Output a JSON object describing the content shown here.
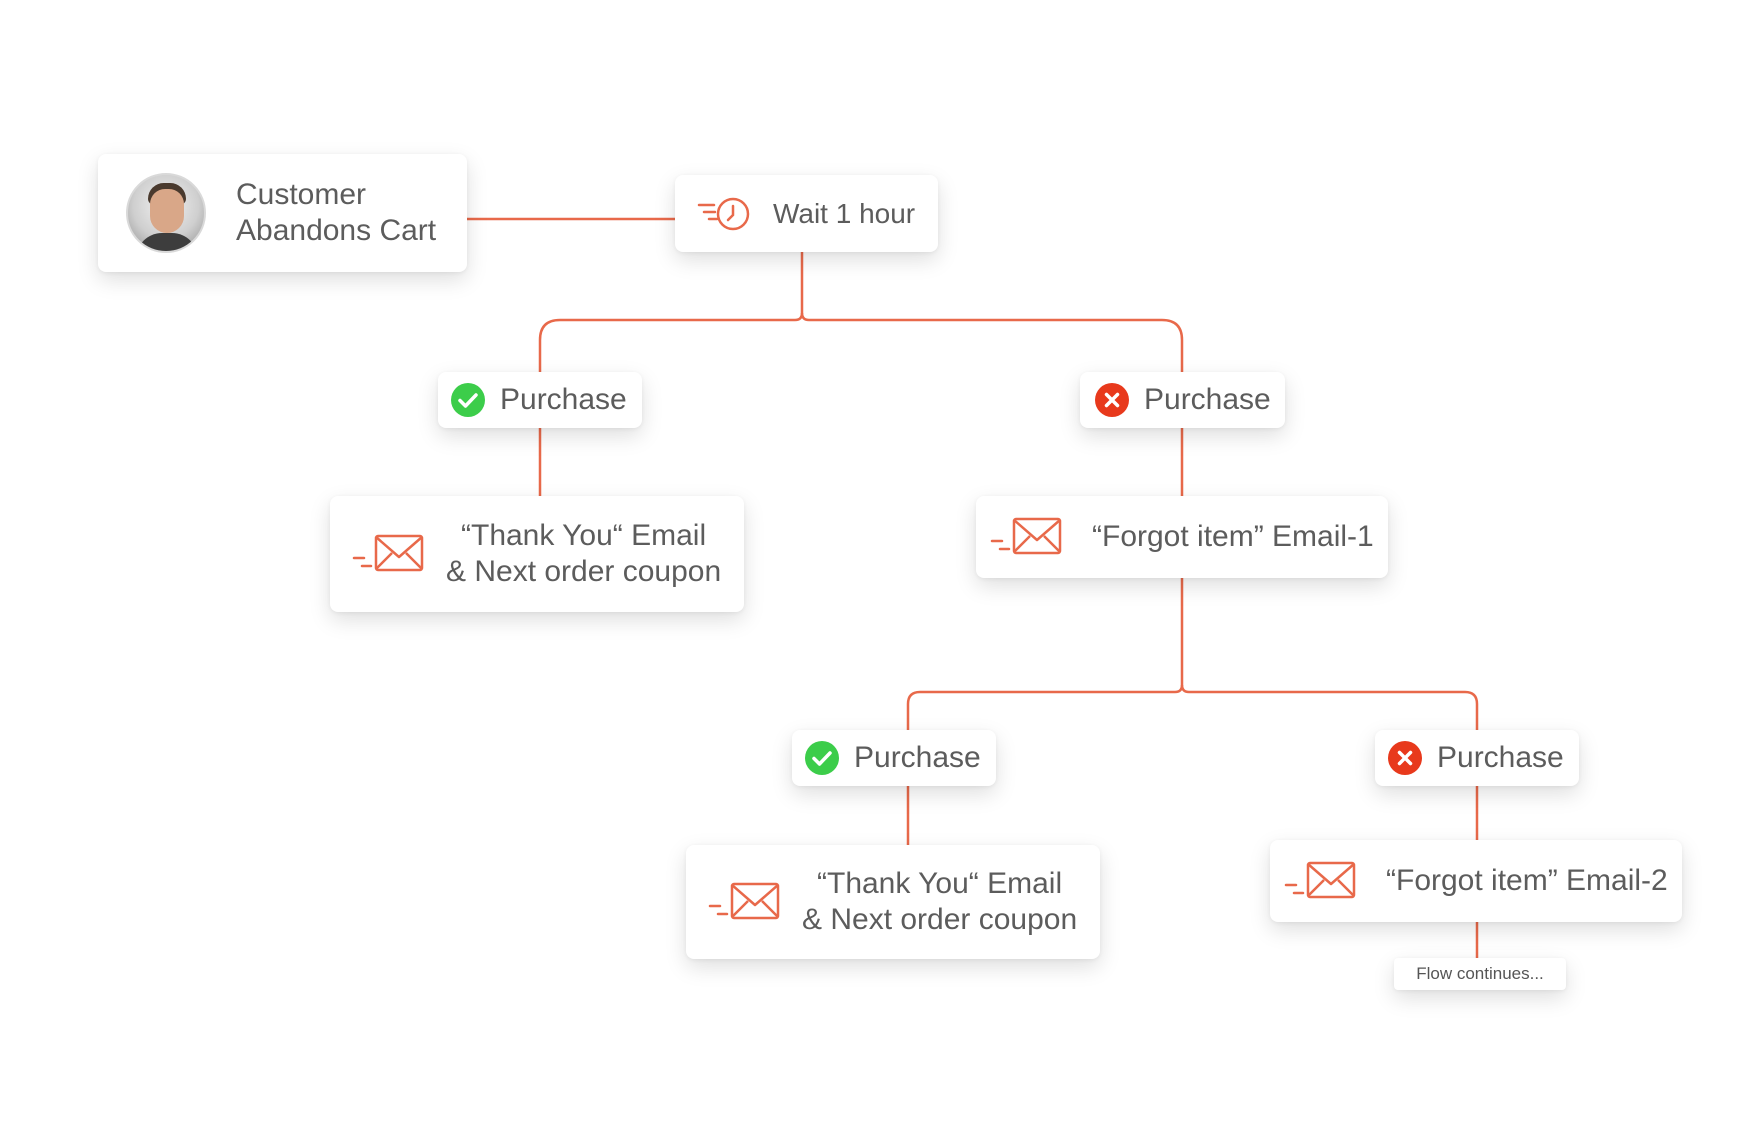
{
  "colors": {
    "connector": "#e8694a",
    "accent": "#e8694a",
    "success": "#3ccd4a",
    "failure": "#e8391c",
    "text": "#5c5c5c"
  },
  "nodes": {
    "trigger": {
      "line1": "Customer",
      "line2": "Abandons Cart",
      "icon": "avatar"
    },
    "wait": {
      "label": "Wait 1 hour",
      "icon": "timer-icon"
    },
    "purchase_yes_1": {
      "label": "Purchase",
      "icon": "check-circle-icon"
    },
    "purchase_no_1": {
      "label": "Purchase",
      "icon": "x-circle-icon"
    },
    "thankyou_1": {
      "line1": "“Thank You“ Email",
      "line2": "& Next order coupon",
      "icon": "email-icon"
    },
    "forgot_1": {
      "label": "“Forgot item” Email-1",
      "icon": "email-icon"
    },
    "purchase_yes_2": {
      "label": "Purchase",
      "icon": "check-circle-icon"
    },
    "purchase_no_2": {
      "label": "Purchase",
      "icon": "x-circle-icon"
    },
    "thankyou_2": {
      "line1": "“Thank You“ Email",
      "line2": "& Next order coupon",
      "icon": "email-icon"
    },
    "forgot_2": {
      "label": "“Forgot item” Email-2",
      "icon": "email-icon"
    },
    "continues": {
      "label": "Flow continues..."
    }
  }
}
